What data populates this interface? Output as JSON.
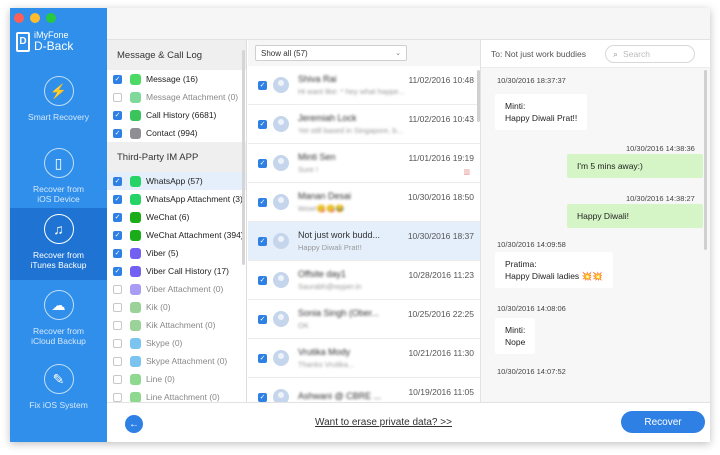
{
  "app": {
    "brand_small": "iMyFone",
    "brand_large": "D-Back",
    "logo_letter": "D"
  },
  "sidebar": {
    "items": [
      {
        "id": "smart",
        "line1": "Smart Recovery",
        "line2": "",
        "icon": "lightning-icon",
        "glyph": "⚡"
      },
      {
        "id": "ios",
        "line1": "Recover from",
        "line2": "iOS Device",
        "icon": "phone-icon",
        "glyph": "▯"
      },
      {
        "id": "itunes",
        "line1": "Recover from",
        "line2": "iTunes Backup",
        "icon": "music-note-icon",
        "glyph": "♫"
      },
      {
        "id": "icloud",
        "line1": "Recover from",
        "line2": "iCloud Backup",
        "icon": "cloud-icon",
        "glyph": "☁"
      },
      {
        "id": "fix",
        "line1": "Fix iOS System",
        "line2": "",
        "icon": "wrench-icon",
        "glyph": "✎"
      }
    ]
  },
  "categories": {
    "section1": "Message & Call Log",
    "section2": "Third-Party IM APP",
    "group1": [
      {
        "label": "Message (16)",
        "checked": true,
        "color": "#4cd964"
      },
      {
        "label": "Message Attachment (0)",
        "checked": false,
        "color": "#7fd99a"
      },
      {
        "label": "Call History (6681)",
        "checked": true,
        "color": "#3cc45c"
      },
      {
        "label": "Contact (994)",
        "checked": true,
        "color": "#8e8e93"
      }
    ],
    "group2": [
      {
        "label": "WhatsApp (57)",
        "checked": true,
        "color": "#25d366",
        "selected": true
      },
      {
        "label": "WhatsApp Attachment (3)",
        "checked": true,
        "color": "#25d366"
      },
      {
        "label": "WeChat (6)",
        "checked": true,
        "color": "#1aad19"
      },
      {
        "label": "WeChat Attachment (394)",
        "checked": true,
        "color": "#1aad19"
      },
      {
        "label": "Viber (5)",
        "checked": true,
        "color": "#7360f2"
      },
      {
        "label": "Viber Call History (17)",
        "checked": true,
        "color": "#7360f2"
      },
      {
        "label": "Viber Attachment (0)",
        "checked": false,
        "color": "#a99cf5"
      },
      {
        "label": "Kik (0)",
        "checked": false,
        "color": "#9ad29a"
      },
      {
        "label": "Kik Attachment (0)",
        "checked": false,
        "color": "#9ad29a"
      },
      {
        "label": "Skype (0)",
        "checked": false,
        "color": "#7cc4f0"
      },
      {
        "label": "Skype Attachment (0)",
        "checked": false,
        "color": "#7cc4f0"
      },
      {
        "label": "Line (0)",
        "checked": false,
        "color": "#8fd88f"
      },
      {
        "label": "Line Attachment (0)",
        "checked": false,
        "color": "#8fd88f"
      }
    ]
  },
  "list": {
    "filter": "Show all (57)",
    "rows": [
      {
        "name": "Shiva Rai",
        "preview": "Hi want like: * hey what happe...",
        "date": "11/02/2016 10:48",
        "blurred": true
      },
      {
        "name": "Jeremiah Lock",
        "preview": "Yet still based in Singapore, b...",
        "date": "11/02/2016 10:43",
        "blurred": true
      },
      {
        "name": "Minti Sen",
        "preview": "Sure !",
        "date": "11/01/2016 19:19",
        "blurred": true,
        "trash": true
      },
      {
        "name": "Manan Desai",
        "preview": "Wow!😋😋😂",
        "date": "10/30/2016 18:50",
        "blurred": true
      },
      {
        "name": "Not just work budd...",
        "preview": "Happy Diwali Prat!!",
        "date": "10/30/2016 18:37",
        "blurred": false,
        "selected": true
      },
      {
        "name": "Offsite day1",
        "preview": "Saurabh@wyper.in",
        "date": "10/28/2016 11:23",
        "blurred": true
      },
      {
        "name": "Sonia Singh (Ober...",
        "preview": "OK",
        "date": "10/25/2016 22:25",
        "blurred": true
      },
      {
        "name": "Vrutika Mody",
        "preview": "Thanks Vrutika...",
        "date": "10/21/2016 11:30",
        "blurred": true
      },
      {
        "name": "Ashwani @ CBRE ...",
        "preview": "",
        "date": "10/19/2016 11:05",
        "blurred": true
      }
    ]
  },
  "search": {
    "placeholder": "Search"
  },
  "chat": {
    "to_label": "To:",
    "to_name": "Not just work buddies",
    "t1": "10/30/2016 18:37:37",
    "m1_l1": "Minti:",
    "m1_l2": "Happy Diwali Prat!!",
    "t2": "10/30/2016 14:38:36",
    "m2": "I'm 5 mins away:)",
    "t3": "10/30/2016 14:38:27",
    "m3": "Happy Diwali!",
    "t4": "10/30/2016 14:09:58",
    "m4_l1": "Pratima:",
    "m4_l2": "Happy Diwali ladies 💥💥",
    "t5": "10/30/2016 14:08:06",
    "m5_l1": "Minti:",
    "m5_l2": "Nope",
    "t6": "10/30/2016 14:07:52"
  },
  "bottom": {
    "erase_link": "Want to erase private data? >>",
    "recover": "Recover",
    "back_glyph": "←"
  },
  "colors": {
    "accent": "#2f80e4",
    "sidebar": "#2f8fea",
    "out_bubble": "#d5f5c6"
  }
}
